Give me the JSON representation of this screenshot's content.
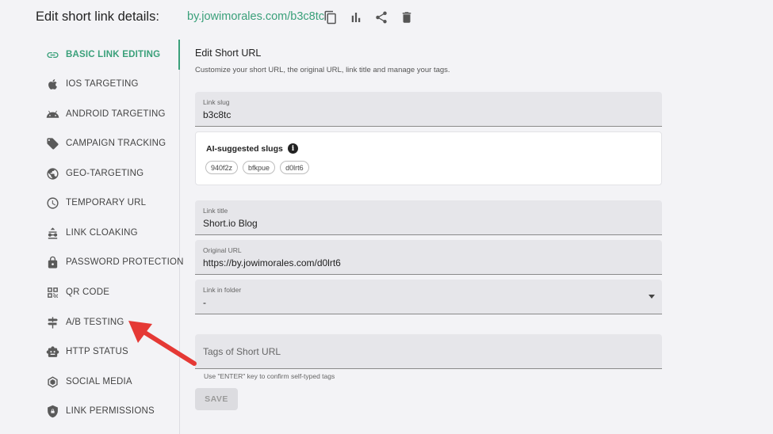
{
  "header": {
    "title": "Edit short link details:",
    "short_link": "by.jowimorales.com/b3c8tc",
    "icons": [
      "copy-icon",
      "stats-icon",
      "share-icon",
      "delete-icon"
    ]
  },
  "sidebar": {
    "items": [
      {
        "label": "BASIC LINK EDITING",
        "icon": "link-icon",
        "active": true
      },
      {
        "label": "IOS TARGETING",
        "icon": "apple-icon"
      },
      {
        "label": "ANDROID TARGETING",
        "icon": "android-icon"
      },
      {
        "label": "CAMPAIGN TRACKING",
        "icon": "tag-icon"
      },
      {
        "label": "GEO-TARGETING",
        "icon": "globe-icon"
      },
      {
        "label": "TEMPORARY URL",
        "icon": "clock-icon"
      },
      {
        "label": "LINK CLOAKING",
        "icon": "spy-icon"
      },
      {
        "label": "PASSWORD PROTECTION",
        "icon": "lock-icon"
      },
      {
        "label": "QR CODE",
        "icon": "qr-code-icon"
      },
      {
        "label": "A/B TESTING",
        "icon": "signpost-icon"
      },
      {
        "label": "HTTP STATUS",
        "icon": "robot-icon"
      },
      {
        "label": "SOCIAL MEDIA",
        "icon": "social-icon"
      },
      {
        "label": "LINK PERMISSIONS",
        "icon": "shield-lock-icon"
      }
    ]
  },
  "main": {
    "title": "Edit Short URL",
    "description": "Customize your short URL, the original URL, link title and manage your tags.",
    "slug": {
      "label": "Link slug",
      "value": "b3c8tc"
    },
    "ai": {
      "title": "AI-suggested slugs",
      "info": "i",
      "chips": [
        "940f2z",
        "bfkpue",
        "d0lrt6"
      ]
    },
    "link_title": {
      "label": "Link title",
      "value": "Short.io Blog"
    },
    "original_url": {
      "label": "Original URL",
      "value": "https://by.jowimorales.com/d0lrt6"
    },
    "folder": {
      "label": "Link in folder",
      "value": "-"
    },
    "tags": {
      "placeholder": "Tags of Short URL",
      "helper": "Use \"ENTER\" key to confirm self-typed tags"
    },
    "save_label": "SAVE"
  },
  "colors": {
    "accent": "#3aa07a",
    "annotation_arrow": "#e53935"
  }
}
